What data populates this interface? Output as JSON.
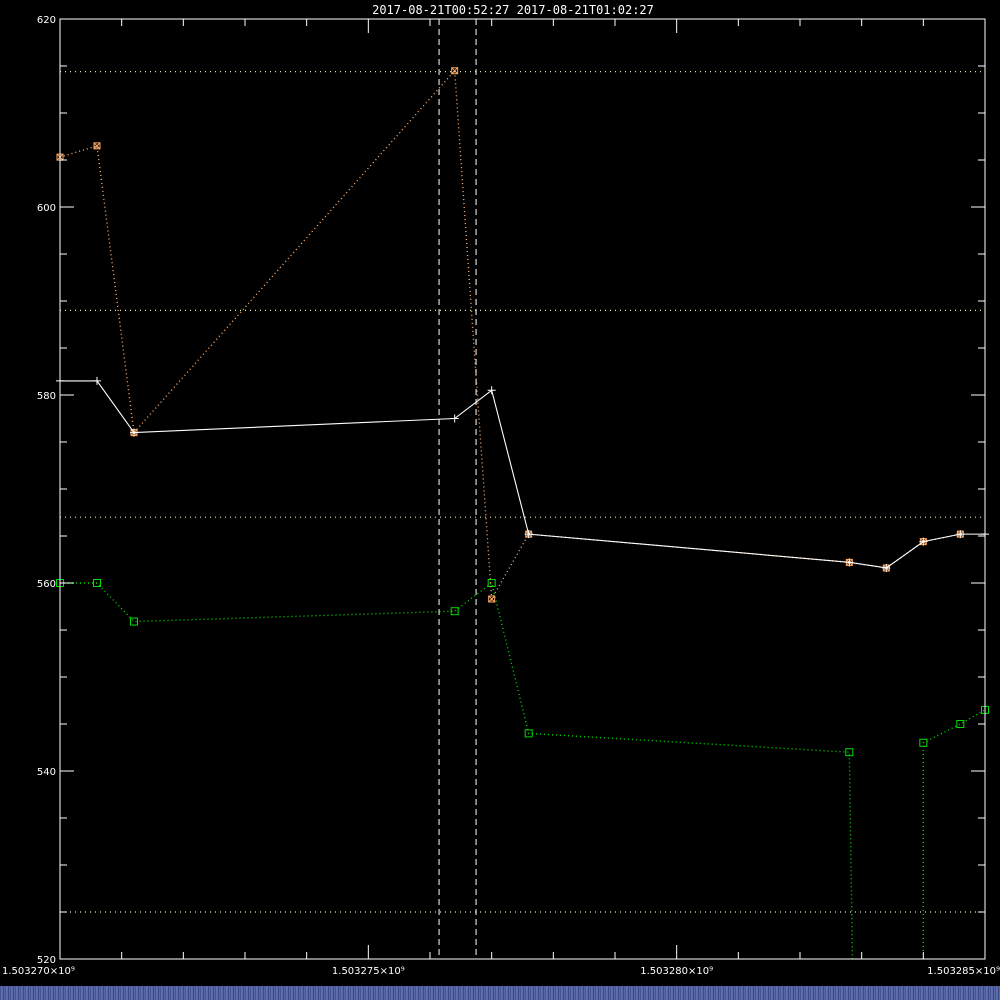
{
  "chart_data": {
    "type": "line",
    "title": "2017-08-21T00:52:27   2017-08-21T01:02:27",
    "xlabel": "",
    "ylabel": "",
    "xlim": [
      1503270000,
      1503285000
    ],
    "ylim": [
      520,
      620
    ],
    "xticks": [
      {
        "value": 1503270000,
        "label": "1.503270×10⁹"
      },
      {
        "value": 1503275000,
        "label": "1.503275×10⁹"
      },
      {
        "value": 1503280000,
        "label": "1.503280×10⁹"
      },
      {
        "value": 1503285000,
        "label": "1.503285×10⁹"
      }
    ],
    "yticks": [
      520,
      540,
      560,
      580,
      600,
      620
    ],
    "vertical_lines": [
      1503276147,
      1503276747
    ],
    "horizontal_lines": [
      614.4,
      589.0,
      567.0,
      525.0
    ],
    "grid": false,
    "series": [
      {
        "color": "#ffffff",
        "style": "solid",
        "marker": "plus",
        "points": [
          [
            1503270000,
            581.5
          ],
          [
            1503270600,
            581.5
          ],
          [
            1503271200,
            576.0
          ],
          [
            1503276400,
            577.5
          ],
          [
            1503277000,
            580.5
          ],
          [
            1503277600,
            565.2
          ],
          [
            1503282800,
            562.2
          ],
          [
            1503283400,
            561.6
          ],
          [
            1503284000,
            564.4
          ],
          [
            1503284600,
            565.2
          ],
          [
            1503285000,
            565.2
          ]
        ]
      },
      {
        "color": "#ffaa66",
        "style": "dotted",
        "marker": "square-x",
        "points": [
          [
            1503270000,
            605.3
          ],
          [
            1503270600,
            606.5
          ],
          [
            1503271200,
            576.0
          ],
          [
            1503276400,
            614.5
          ],
          [
            1503277000,
            558.3
          ],
          [
            1503277600,
            565.2
          ],
          [
            1503282800,
            562.2
          ],
          [
            1503283400,
            561.6
          ],
          [
            1503284000,
            564.4
          ],
          [
            1503284600,
            565.2
          ]
        ]
      },
      {
        "color": "#00dd00",
        "style": "dotted",
        "marker": "square",
        "points": [
          [
            1503270000,
            560.0
          ],
          [
            1503270600,
            560.0
          ],
          [
            1503271200,
            555.9
          ],
          [
            1503276400,
            557.0
          ],
          [
            1503277000,
            560.0
          ],
          [
            1503277600,
            544.0
          ],
          [
            1503282800,
            542.0
          ],
          [
            1503282850,
            520.0
          ]
        ]
      },
      {
        "color": "#00dd00",
        "style": "dotted",
        "marker": "square",
        "points": [
          [
            1503284000,
            520.0
          ],
          [
            1503284000,
            543.0
          ],
          [
            1503284600,
            545.0
          ],
          [
            1503285000,
            546.5
          ]
        ]
      }
    ]
  }
}
